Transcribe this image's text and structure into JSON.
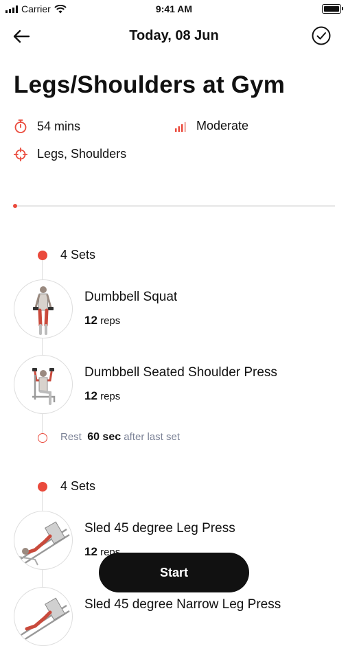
{
  "status_bar": {
    "carrier": "Carrier",
    "time": "9:41 AM"
  },
  "nav": {
    "title": "Today, 08 Jun"
  },
  "workout": {
    "title": "Legs/Shoulders at Gym",
    "duration": "54 mins",
    "intensity": "Moderate",
    "muscles": "Legs, Shoulders",
    "progress_fraction": 0.0
  },
  "accent_color": "#ea4a3c",
  "blocks": [
    {
      "sets_label": "4 Sets",
      "exercises": [
        {
          "name": "Dumbbell Squat",
          "reps_value": "12",
          "reps_unit": "reps"
        },
        {
          "name": "Dumbbell Seated Shoulder Press",
          "reps_value": "12",
          "reps_unit": "reps"
        }
      ],
      "rest": {
        "prefix": "Rest",
        "value": "60 sec",
        "suffix": "after last set"
      }
    },
    {
      "sets_label": "4 Sets",
      "exercises": [
        {
          "name": "Sled 45 degree Leg Press",
          "reps_value": "12",
          "reps_unit": "reps"
        },
        {
          "name": "Sled 45 degree Narrow Leg Press",
          "reps_value": "",
          "reps_unit": ""
        }
      ]
    }
  ],
  "start_button": {
    "label": "Start"
  }
}
